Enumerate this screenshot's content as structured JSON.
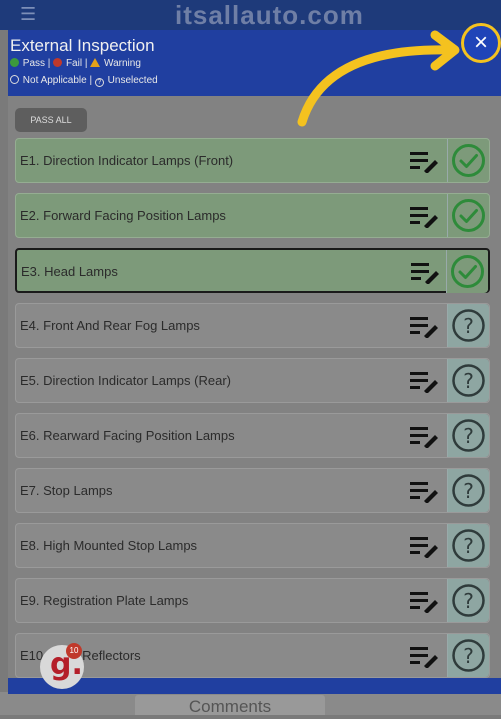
{
  "background": {
    "site_title": "itsallauto.com",
    "bottom_label": "Comments"
  },
  "modal": {
    "title": "External Inspection",
    "legend": {
      "pass": "Pass |",
      "fail": "Fail |",
      "warning": "Warning",
      "not_applicable": "Not Applicable |",
      "unselected": "Unselected"
    },
    "pass_all_label": "PASS ALL",
    "close_glyph": "×"
  },
  "items": [
    {
      "label": "E1. Direction Indicator Lamps (Front)",
      "status": "pass"
    },
    {
      "label": "E2. Forward Facing Position Lamps",
      "status": "pass"
    },
    {
      "label": "E3. Head Lamps",
      "status": "pass"
    },
    {
      "label": "E4. Front And Rear Fog Lamps",
      "status": "unselected"
    },
    {
      "label": "E5. Direction Indicator Lamps (Rear)",
      "status": "unselected"
    },
    {
      "label": "E6. Rearward Facing Position Lamps",
      "status": "unselected"
    },
    {
      "label": "E7. Stop Lamps",
      "status": "unselected"
    },
    {
      "label": "E8. High Mounted Stop Lamps",
      "status": "unselected"
    },
    {
      "label": "E9. Registration Plate Lamps",
      "status": "unselected"
    },
    {
      "label": "E10. Rear Reflectors",
      "status": "unselected"
    }
  ],
  "logo": {
    "letter": "g.",
    "badge": "10"
  },
  "colors": {
    "header": "#203fa0",
    "highlight": "#f4c21f",
    "pass": "#2e8b3a"
  }
}
